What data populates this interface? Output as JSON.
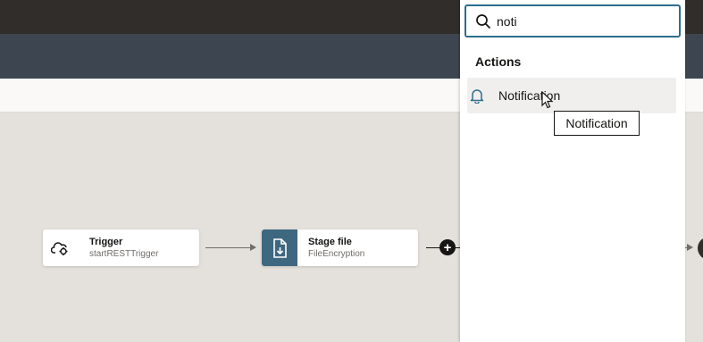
{
  "search": {
    "value": "noti",
    "icon": "search-icon"
  },
  "panel": {
    "section_title": "Actions",
    "results": [
      {
        "label": "Notification",
        "icon": "bell-icon"
      }
    ]
  },
  "tooltip": {
    "text": "Notification"
  },
  "flow": {
    "nodes": [
      {
        "title": "Trigger",
        "subtitle": "startRESTTrigger",
        "icon": "cloud-gear-icon"
      },
      {
        "title": "Stage file",
        "subtitle": "FileEncryption",
        "icon": "stage-file-icon",
        "accent": "#3e6880"
      }
    ],
    "add_icon": "plus-icon"
  },
  "colors": {
    "topbar": "#312d2a",
    "subbar": "#3d4650",
    "canvas": "#e4e1dc",
    "search_border": "#2c6e8e",
    "stage_accent": "#3e6880"
  }
}
